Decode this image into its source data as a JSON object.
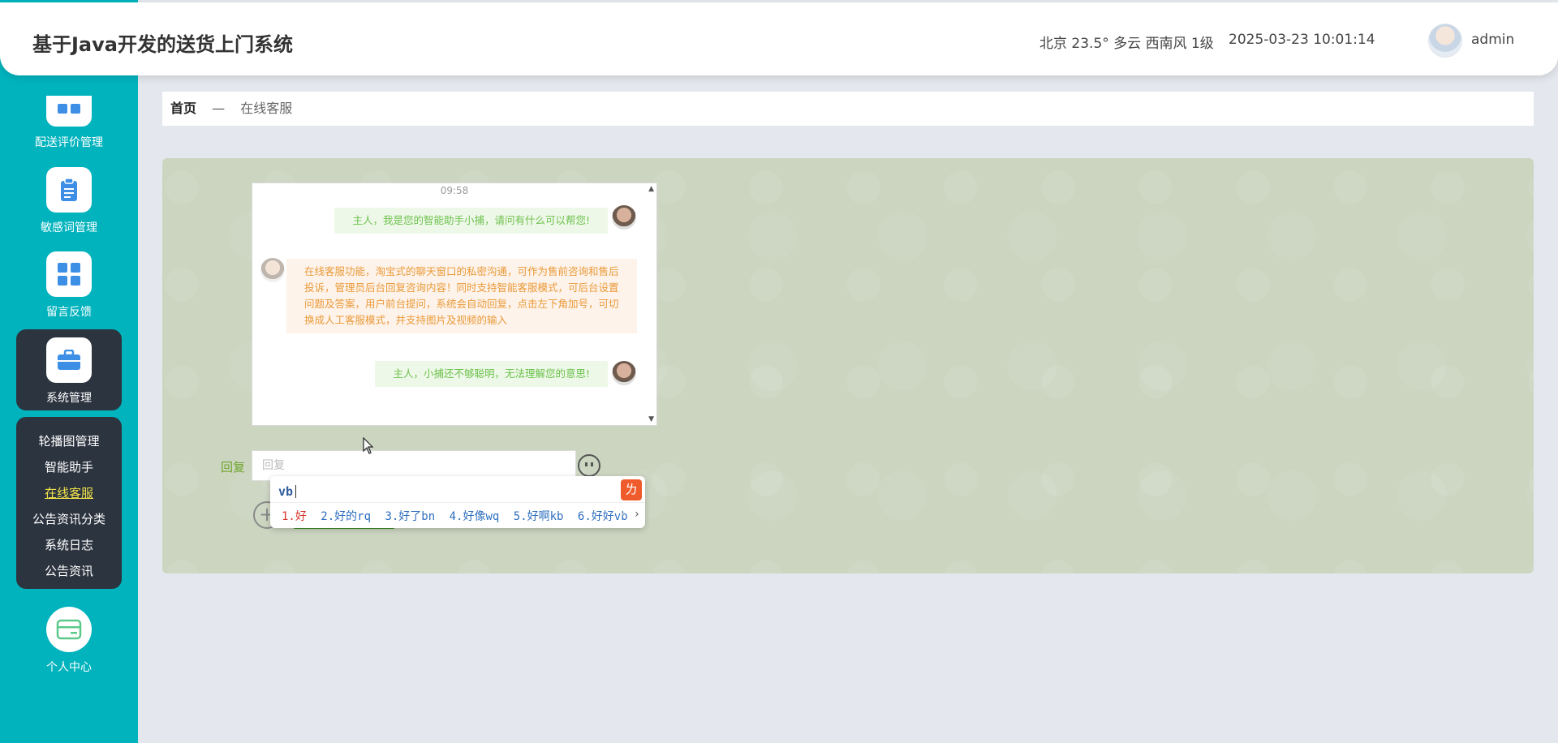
{
  "header": {
    "title": "基于Java开发的送货上门系统",
    "weather": "北京  23.5°  多云  西南风  1级",
    "datetime": "2025-03-23 10:01:14",
    "username": "admin"
  },
  "sidebar": {
    "items": [
      {
        "label": "配送评价管理",
        "icon": "grid-icon"
      },
      {
        "label": "敏感词管理",
        "icon": "clipboard-icon"
      },
      {
        "label": "留言反馈",
        "icon": "grid-icon"
      },
      {
        "label": "系统管理",
        "icon": "briefcase-icon"
      },
      {
        "label": "个人中心",
        "icon": "card-icon"
      }
    ],
    "submenu": [
      {
        "label": "轮播图管理"
      },
      {
        "label": "智能助手"
      },
      {
        "label": "在线客服"
      },
      {
        "label": "公告资讯分类"
      },
      {
        "label": "系统日志"
      },
      {
        "label": "公告资讯"
      }
    ]
  },
  "breadcrumb": {
    "home": "首页",
    "separator": "—",
    "current": "在线客服"
  },
  "chat": {
    "time": "09:58",
    "messages": [
      {
        "text": "主人，我是您的智能助手小捕，请问有什么可以帮您!"
      },
      {
        "text": "在线客服功能，淘宝式的聊天窗口的私密沟通，可作为售前咨询和售后投诉，管理员后台回复咨询内容！同时支持智能客服模式，可后台设置问题及答案，用户前台提问，系统会自动回复，点击左下角加号，可切换成人工客服模式，并支持图片及视频的输入"
      },
      {
        "text": "主人，小捕还不够聪明，无法理解您的意思!"
      }
    ],
    "reply_label": "回复",
    "reply_placeholder": "回复"
  },
  "ime": {
    "code": "vb",
    "candidates": [
      "1.好",
      "2.好的rq",
      "3.好了bn",
      "4.好像wq",
      "5.好啊kb",
      "6.好好vb"
    ],
    "next_arrow": "›",
    "prev_arrow": "‹"
  }
}
